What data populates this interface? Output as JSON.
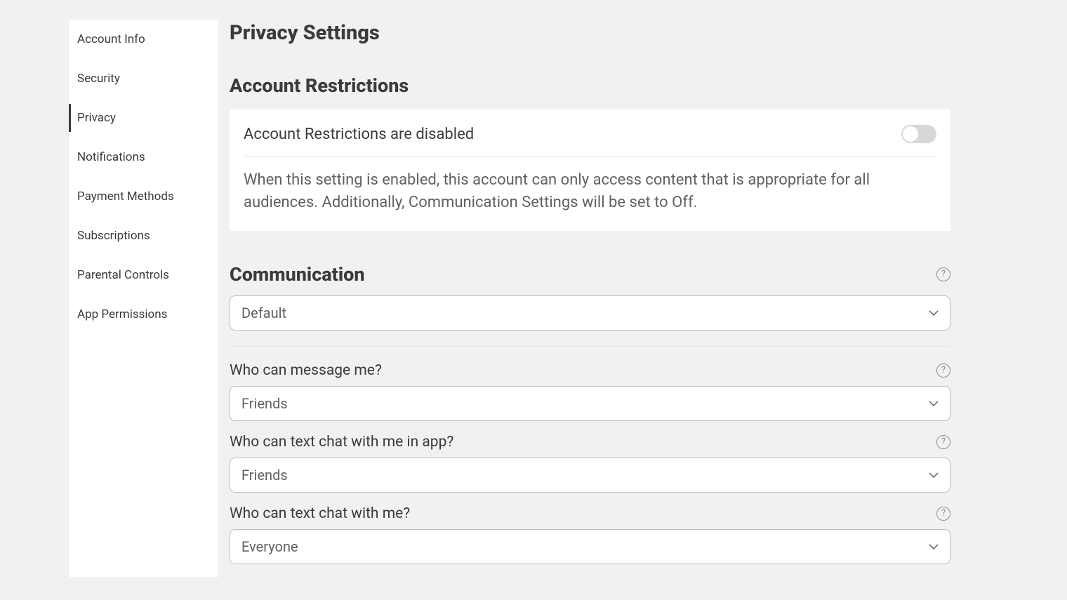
{
  "sidebar": {
    "items": [
      {
        "label": "Account Info"
      },
      {
        "label": "Security"
      },
      {
        "label": "Privacy"
      },
      {
        "label": "Notifications"
      },
      {
        "label": "Payment Methods"
      },
      {
        "label": "Subscriptions"
      },
      {
        "label": "Parental Controls"
      },
      {
        "label": "App Permissions"
      }
    ],
    "activeIndex": 2
  },
  "main": {
    "pageTitle": "Privacy Settings",
    "accountRestrictions": {
      "sectionTitle": "Account Restrictions",
      "statusLabel": "Account Restrictions are disabled",
      "description": "When this setting is enabled, this account can only access content that is appropriate for all audiences. Additionally, Communication Settings will be set to Off.",
      "enabled": false
    },
    "communication": {
      "sectionTitle": "Communication",
      "mode": "Default",
      "settings": [
        {
          "label": "Who can message me?",
          "value": "Friends"
        },
        {
          "label": "Who can text chat with me in app?",
          "value": "Friends"
        },
        {
          "label": "Who can text chat with me?",
          "value": "Everyone"
        }
      ]
    }
  }
}
